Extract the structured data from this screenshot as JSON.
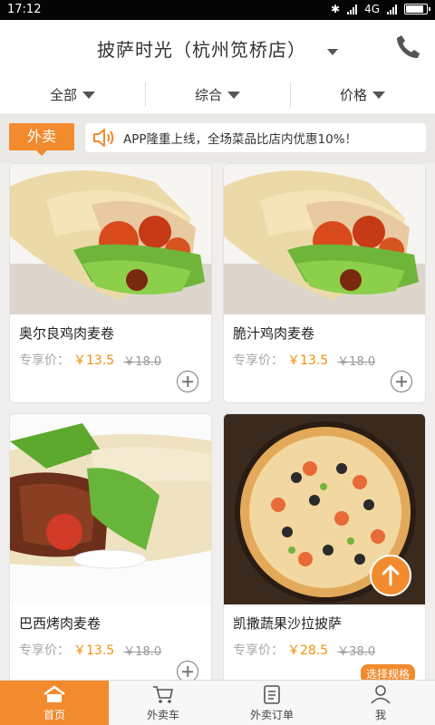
{
  "status": {
    "time": "17:12",
    "network": "4G"
  },
  "header": {
    "title": "披萨时光（杭州笕桥店）",
    "icons": [
      "chevron-down-icon",
      "phone-icon"
    ]
  },
  "filters": [
    {
      "label": "全部"
    },
    {
      "label": "综合"
    },
    {
      "label": "价格"
    }
  ],
  "notice": {
    "tag": "外卖",
    "text": "APP隆重上线，全场菜品比店内优惠10%！"
  },
  "products": [
    {
      "name": "奥尔良鸡肉麦卷",
      "price_label": "专享价：",
      "price": "￥13.5",
      "old_price": "￥18.0"
    },
    {
      "name": "脆汁鸡肉麦卷",
      "price_label": "专享价：",
      "price": "￥13.5",
      "old_price": "￥18.0"
    },
    {
      "name": "巴西烤肉麦卷",
      "price_label": "专享价：",
      "price": "￥13.5",
      "old_price": "￥18.0"
    },
    {
      "name": "凯撒蔬果沙拉披萨",
      "price_label": "专享价：",
      "price": "￥28.5",
      "old_price": "￥38.0",
      "spec": "选择规格"
    }
  ],
  "tabs": [
    {
      "label": "首页",
      "icon": "home-icon"
    },
    {
      "label": "外卖车",
      "icon": "cart-icon"
    },
    {
      "label": "外卖订单",
      "icon": "order-icon"
    },
    {
      "label": "我",
      "icon": "user-icon"
    }
  ],
  "colors": {
    "accent": "#f28a2e",
    "price": "#f0900e"
  }
}
